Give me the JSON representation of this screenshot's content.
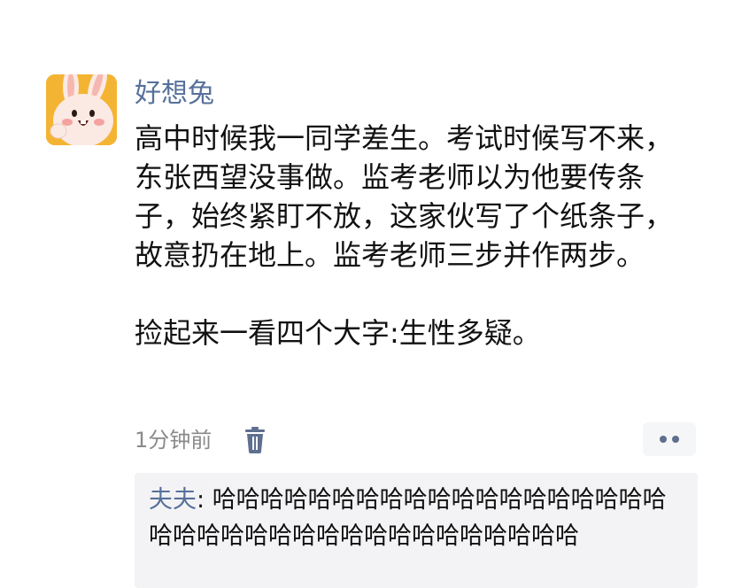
{
  "post": {
    "username": "好想兔",
    "paragraphs": [
      "高中时候我一同学差生。考试时候写不来，东张西望没事做。监考老师以为他要传条子，始终紧盯不放，这家伙写了个纸条子，故意扔在地上。监考老师三步并作两步。",
      "捡起来一看四个大字:生性多疑。"
    ],
    "time": "1分钟前",
    "icons": {
      "avatar": "bunny-avatar",
      "delete": "trash-icon",
      "more": "more-dots-icon"
    }
  },
  "comment": {
    "author": "夫夫",
    "separator": ": ",
    "text": "哈哈哈哈哈哈哈哈哈哈哈哈哈哈哈哈哈哈哈哈哈哈哈哈哈哈哈哈哈哈哈哈哈哈哈哈哈"
  },
  "colors": {
    "name": "#57709a",
    "avatar_bg": "#f4b433",
    "comment_bg": "#f3f3f5",
    "meta": "#8a8a8a"
  }
}
